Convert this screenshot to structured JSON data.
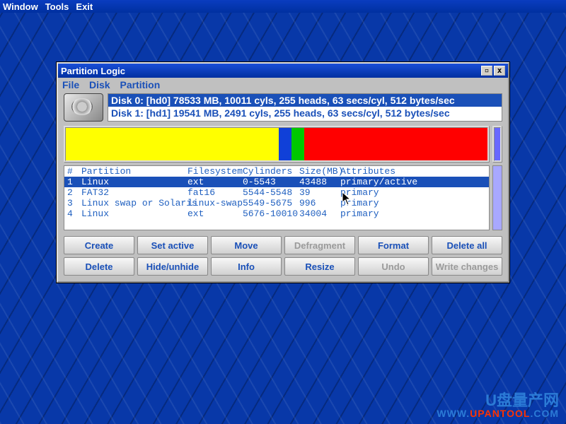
{
  "top_menu": {
    "items": [
      "Window",
      "Tools",
      "Exit"
    ]
  },
  "window": {
    "title": "Partition Logic",
    "menu": [
      "File",
      "Disk",
      "Partition"
    ]
  },
  "disks": [
    {
      "text": "Disk 0: [hd0] 78533 MB, 10011 cyls, 255 heads, 63 secs/cyl, 512 bytes/sec",
      "selected": true
    },
    {
      "text": "Disk 1: [hd1] 19541 MB, 2491 cyls, 255 heads, 63 secs/cyl, 512 bytes/sec",
      "selected": false
    }
  ],
  "partitions": {
    "headers": {
      "num": "#",
      "partition": "Partition",
      "fs": "Filesystem",
      "cyl": "Cylinders",
      "size": "Size(MB)",
      "attr": "Attributes"
    },
    "rows": [
      {
        "num": "1",
        "partition": "Linux",
        "fs": "ext",
        "cyl": "0-5543",
        "size": "43488",
        "attr": "primary/active",
        "selected": true
      },
      {
        "num": "2",
        "partition": "FAT32",
        "fs": "fat16",
        "cyl": "5544-5548",
        "size": "39",
        "attr": "primary",
        "selected": false
      },
      {
        "num": "3",
        "partition": "Linux swap or Solaris",
        "fs": "linux-swap",
        "cyl": "5549-5675",
        "size": "996",
        "attr": "primary",
        "selected": false
      },
      {
        "num": "4",
        "partition": "Linux",
        "fs": "ext",
        "cyl": "5676-10010",
        "size": "34004",
        "attr": "primary",
        "selected": false
      }
    ]
  },
  "segments": [
    {
      "color": "yellow",
      "pct": 50.5
    },
    {
      "color": "blue",
      "pct": 3
    },
    {
      "color": "green",
      "pct": 3
    },
    {
      "color": "red",
      "pct": 43.5
    }
  ],
  "buttons": {
    "row1": [
      {
        "label": "Create",
        "disabled": false
      },
      {
        "label": "Set active",
        "disabled": false
      },
      {
        "label": "Move",
        "disabled": false
      },
      {
        "label": "Defragment",
        "disabled": true
      },
      {
        "label": "Format",
        "disabled": false
      },
      {
        "label": "Delete all",
        "disabled": false
      }
    ],
    "row2": [
      {
        "label": "Delete",
        "disabled": false
      },
      {
        "label": "Hide/unhide",
        "disabled": false
      },
      {
        "label": "Info",
        "disabled": false
      },
      {
        "label": "Resize",
        "disabled": false
      },
      {
        "label": "Undo",
        "disabled": true
      },
      {
        "label": "Write changes",
        "disabled": true
      }
    ]
  },
  "watermark": {
    "line1": "U盘量产网",
    "line2_a": "WWW.",
    "line2_b": "UPANTOOL",
    "line2_c": ".COM"
  }
}
